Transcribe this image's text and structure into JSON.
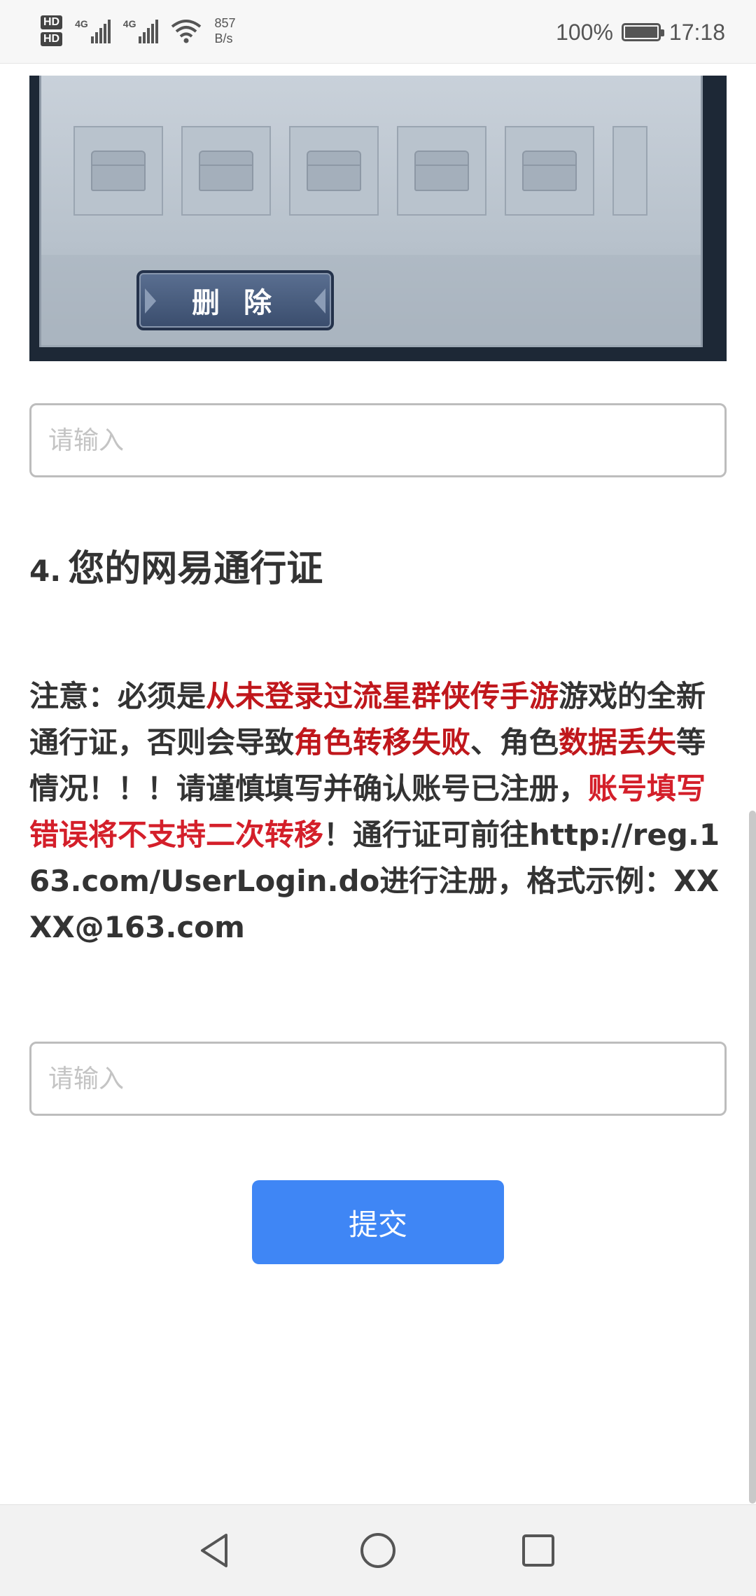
{
  "status_bar": {
    "hd1": "HD",
    "hd2": "HD",
    "signal1_label": "4G",
    "signal2_label": "4G",
    "net_speed_value": "857",
    "net_speed_unit": "B/s",
    "battery_percent": "100%",
    "time": "17:18",
    "icons": [
      "signal-icon",
      "wifi-icon",
      "battery-icon"
    ]
  },
  "game_screenshot": {
    "delete_button_label": "删 除",
    "slot_count_visible": 6,
    "colors": {
      "panel": "#c4ccd5",
      "button": "#3e5273",
      "frame": "#1d2836"
    }
  },
  "form": {
    "input1_placeholder": "请输入",
    "question_number": "4.",
    "question_title": "您的网易通行证",
    "notice": {
      "p1": "注意：必须是",
      "r1": "从未登录过流星群侠传手游",
      "p2": "游戏的全新通行证，否则会导致",
      "r2": "角色转移失败",
      "p3": "、角色",
      "r3": "数据丢失",
      "p4": "等情况！！！请谨慎填写并确认账号已注册，",
      "r4": "账号填写错误将不支持二次转移",
      "p5": "！通行证可前往http://reg.163.com/UserLogin.do进行注册，格式示例：XXXX@163.com"
    },
    "input2_placeholder": "请输入",
    "submit_label": "提交",
    "accent_color": "#3f86f5",
    "warning_color": "#d41f2a"
  },
  "nav_bar": {
    "icons": [
      "back-icon",
      "home-icon",
      "recents-icon"
    ]
  }
}
